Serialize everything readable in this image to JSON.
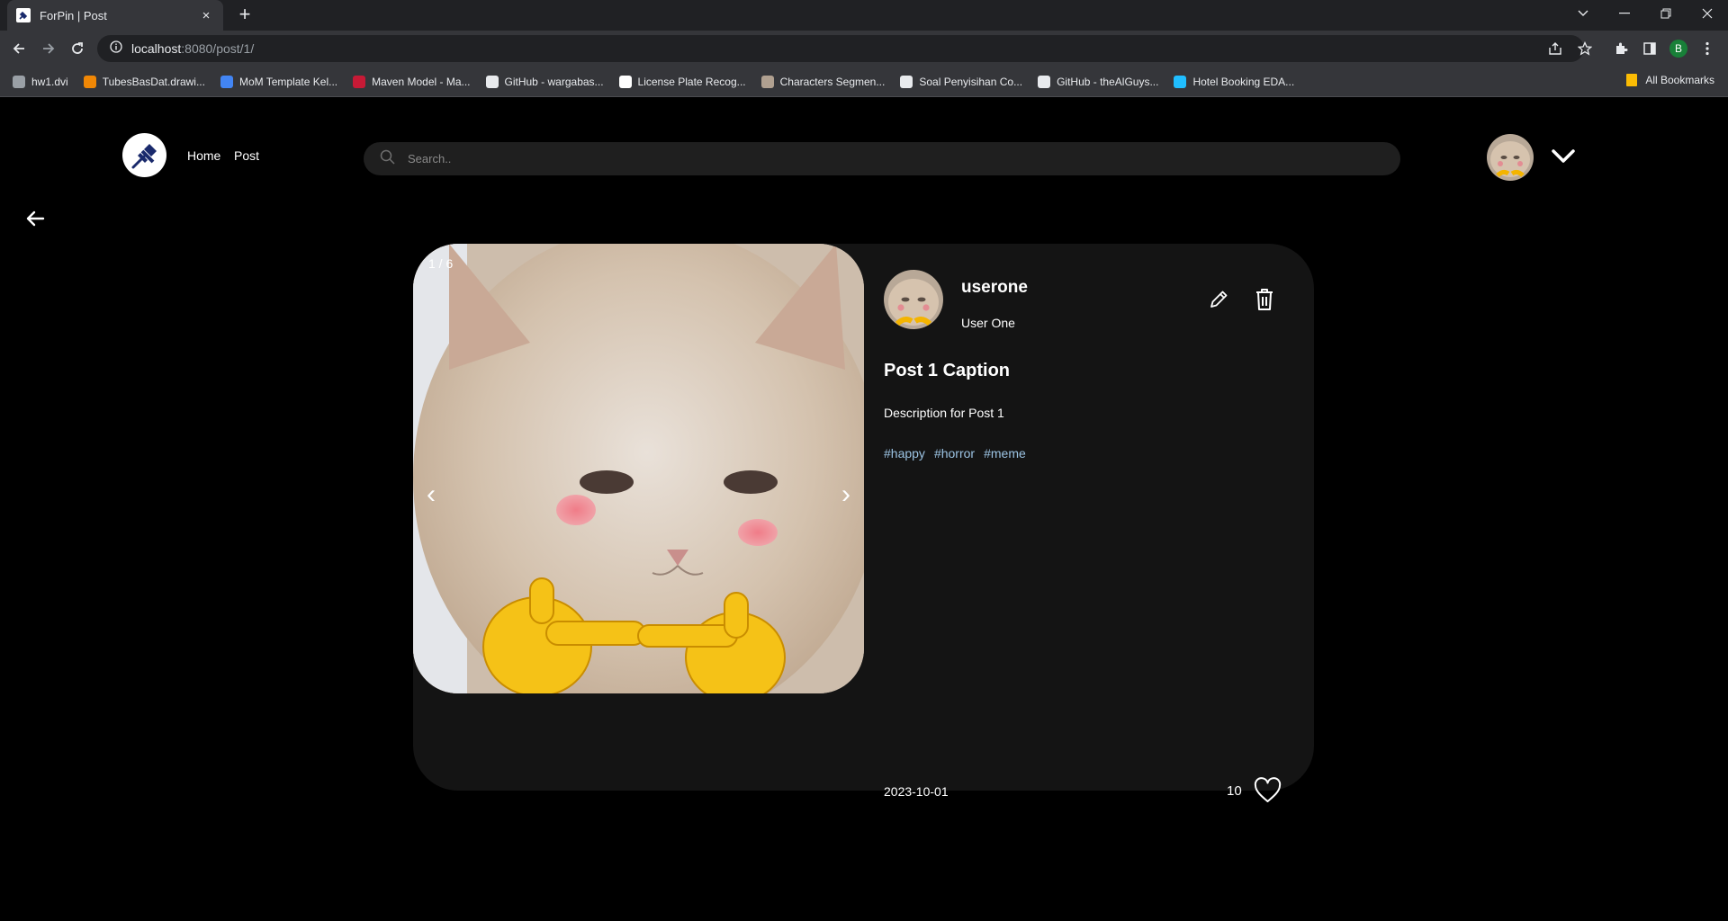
{
  "browser": {
    "tab_title": "ForPin | Post",
    "tab_close": "×",
    "new_tab": "+",
    "url_host": "localhost",
    "url_rest": ":8080/post/1/",
    "bookmarks": [
      {
        "label": "hw1.dvi",
        "color": "#9aa0a6"
      },
      {
        "label": "TubesBasDat.drawi...",
        "color": "#f08705"
      },
      {
        "label": "MoM Template Kel...",
        "color": "#4285f4"
      },
      {
        "label": "Maven Model - Ma...",
        "color": "#c71a36"
      },
      {
        "label": "GitHub - wargabas...",
        "color": "#e8eaed"
      },
      {
        "label": "License Plate Recog...",
        "color": "#ffffff"
      },
      {
        "label": "Characters Segmen...",
        "color": "#b0a090"
      },
      {
        "label": "Soal Penyisihan Co...",
        "color": "#e8eaed"
      },
      {
        "label": "GitHub - theAlGuys...",
        "color": "#e8eaed"
      },
      {
        "label": "Hotel Booking EDA...",
        "color": "#20beff"
      }
    ],
    "all_bookmarks": "All Bookmarks",
    "profile_initial": "B"
  },
  "nav": {
    "home": "Home",
    "post": "Post",
    "search_placeholder": "Search.."
  },
  "post": {
    "counter": "1 / 6",
    "prev_arrow": "‹",
    "next_arrow": "›",
    "username": "userone",
    "fullname": "User One",
    "caption": "Post 1 Caption",
    "description": "Description for Post 1",
    "tags": [
      "#happy",
      "#horror",
      "#meme"
    ],
    "date": "2023-10-01",
    "likes": "10"
  },
  "colors": {
    "page_bg": "#000000",
    "card_bg": "#141414",
    "search_bg": "#1f1f1f",
    "tag": "#9cc4e4"
  }
}
